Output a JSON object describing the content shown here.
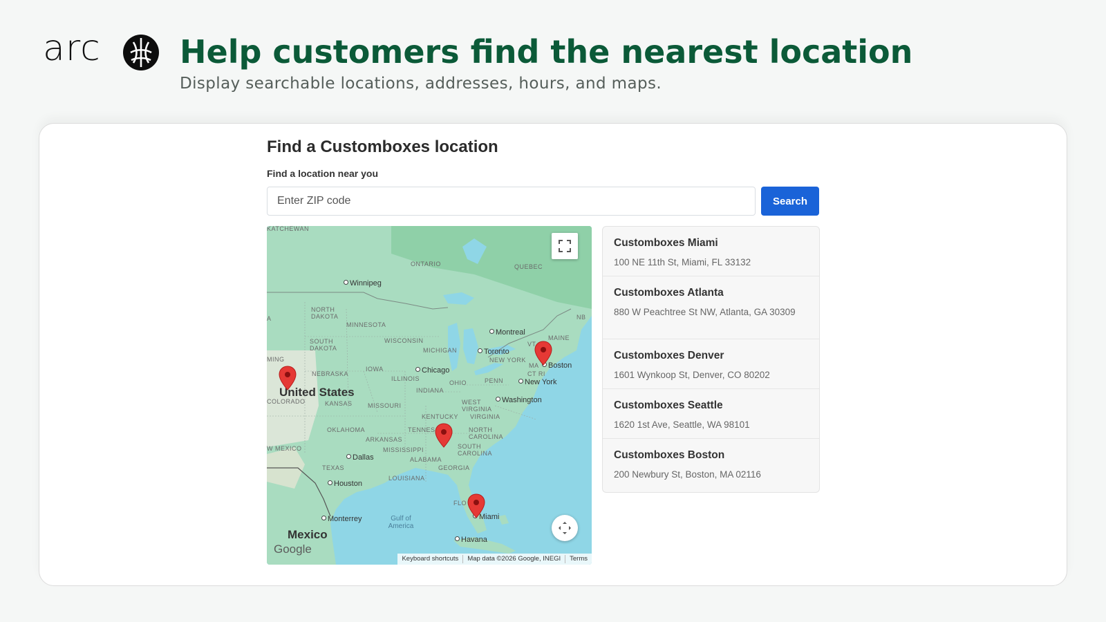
{
  "brand": {
    "logo_text": "arc",
    "logo_icon": "arc-globe-icon"
  },
  "header": {
    "title": "Help customers find the nearest location",
    "subtitle": "Display searchable locations, addresses, hours, and maps."
  },
  "finder": {
    "title": "Find a Customboxes location",
    "search_label": "Find a location near you",
    "zip_placeholder": "Enter ZIP code",
    "search_button": "Search"
  },
  "map": {
    "labels": {
      "country_us": "United States",
      "country_mx": "Mexico",
      "gulf": "Gulf of America",
      "saskatchewan": "KATCHEWAN",
      "ontario": "ONTARIO",
      "quebec": "QUEBEC",
      "north_dakota": "NORTH DAKOTA",
      "minnesota": "MINNESOTA",
      "south_dakota": "SOUTH DAKOTA",
      "wisconsin": "WISCONSIN",
      "michigan": "MICHIGAN",
      "nebraska": "NEBRASKA",
      "iowa": "IOWA",
      "illinois": "ILLINOIS",
      "indiana": "INDIANA",
      "ohio": "OHIO",
      "penn": "PENN",
      "new_york_state": "NEW YORK",
      "vermont": "VT",
      "maine": "MAINE",
      "nb": "NB",
      "ma": "MA",
      "ct_ri": "CT RI",
      "wyoming": "MING",
      "colorado": "COLORADO",
      "kansas": "KANSAS",
      "missouri": "MISSOURI",
      "kentucky": "KENTUCKY",
      "west_virginia": "WEST VIRGINIA",
      "virginia": "VIRGINIA",
      "oklahoma": "OKLAHOMA",
      "arkansas": "ARKANSAS",
      "tennessee": "TENNES",
      "north_carolina": "NORTH CAROLINA",
      "south_carolina": "SOUTH CAROLINA",
      "new_mexico": "W MEXICO",
      "mississippi": "MISSISSIPPI",
      "alabama": "ALABAMA",
      "georgia": "GEORGIA",
      "texas": "TEXAS",
      "louisiana": "LOUISIANA",
      "florida": "FLO",
      "a": "A"
    },
    "cities": {
      "winnipeg": "Winnipeg",
      "montreal": "Montreal",
      "toronto": "Toronto",
      "boston": "Boston",
      "chicago": "Chicago",
      "new_york": "New York",
      "washington": "Washington",
      "dallas": "Dallas",
      "houston": "Houston",
      "monterrey": "Monterrey",
      "miami": "Miami",
      "havana": "Havana"
    },
    "google_logo": "Google",
    "attribution": {
      "shortcuts": "Keyboard shortcuts",
      "data": "Map data ©2026 Google, INEGI",
      "terms": "Terms"
    },
    "pin_color": "#e53935"
  },
  "locations": [
    {
      "name": "Customboxes Miami",
      "address": "100 NE 11th St, Miami, FL 33132"
    },
    {
      "name": "Customboxes Atlanta",
      "address": "880 W Peachtree St NW, Atlanta, GA 30309"
    },
    {
      "name": "Customboxes Denver",
      "address": "1601 Wynkoop St, Denver, CO 80202"
    },
    {
      "name": "Customboxes Seattle",
      "address": "1620 1st Ave, Seattle, WA 98101"
    },
    {
      "name": "Customboxes Boston",
      "address": "200 Newbury St, Boston, MA 02116"
    }
  ],
  "colors": {
    "headline": "#0b5a38",
    "button": "#1a63d8",
    "water": "#8fd6e6",
    "land": "#a8dcbf"
  }
}
